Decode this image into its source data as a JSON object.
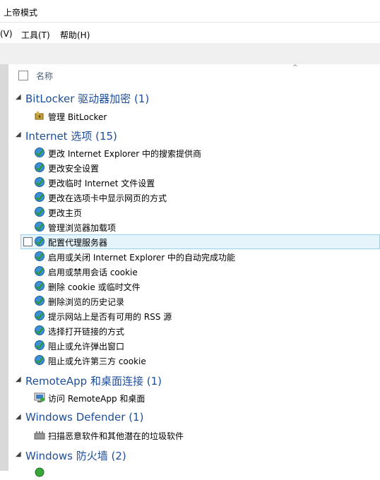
{
  "window": {
    "title": "上帝模式"
  },
  "menu": {
    "view": "(V)",
    "tools": "工具(T)",
    "help": "帮助(H)"
  },
  "header": {
    "name_column": "名称"
  },
  "groups": [
    {
      "title": "BitLocker 驱动器加密 (1)",
      "items": [
        "管理 BitLocker"
      ]
    },
    {
      "title": "Internet 选项 (15)",
      "items": [
        "更改 Internet Explorer 中的搜索提供商",
        "更改安全设置",
        "更改临时 Internet 文件设置",
        "更改在选项卡中显示网页的方式",
        "更改主页",
        "管理浏览器加载项",
        "配置代理服务器",
        "启用或关闭 Internet Explorer 中的自动完成功能",
        "启用或禁用会话 cookie",
        "删除 cookie 或临时文件",
        "删除浏览的历史记录",
        "提示网站上是否有可用的 RSS 源",
        "选择打开链接的方式",
        "阻止或允许弹出窗口",
        "阻止或允许第三方 cookie"
      ]
    },
    {
      "title": "RemoteApp 和桌面连接 (1)",
      "items": [
        "访问 RemoteApp 和桌面"
      ]
    },
    {
      "title": "Windows Defender (1)",
      "items": [
        "扫描恶意软件和其他潜在的垃圾软件"
      ]
    },
    {
      "title": "Windows 防火墙 (2)",
      "items": []
    }
  ],
  "colors": {
    "group_title": "#1e4e9a",
    "selected_bg": "#e5f3fb",
    "selected_border": "#99d1ef"
  }
}
